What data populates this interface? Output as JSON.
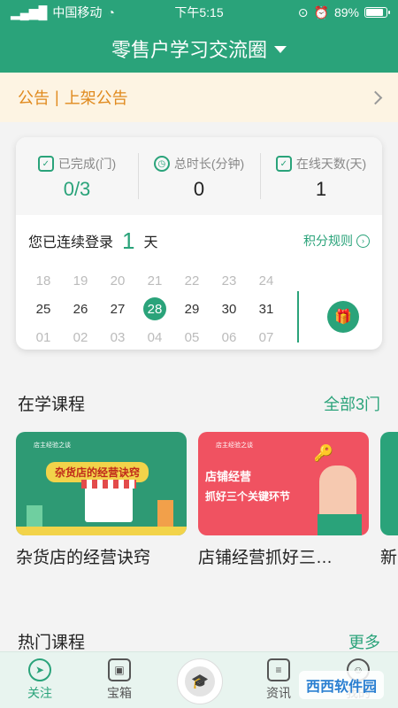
{
  "status": {
    "carrier": "中国移动",
    "time": "下午5:15",
    "battery": "89%",
    "battery_level": 0.89
  },
  "header": {
    "title": "零售户学习交流圈"
  },
  "notice": {
    "label": "公告",
    "separator": "|",
    "text": "上架公告"
  },
  "stats": [
    {
      "label": "已完成(门)",
      "value": "0/3",
      "icon": "check-doc-icon"
    },
    {
      "label": "总时长(分钟)",
      "value": "0",
      "icon": "clock-icon"
    },
    {
      "label": "在线天数(天)",
      "value": "1",
      "icon": "monitor-check-icon"
    }
  ],
  "login": {
    "prefix": "您已连续登录",
    "days": "1",
    "suffix": "天",
    "rule": "积分规则"
  },
  "calendar": {
    "rows": [
      [
        "18",
        "19",
        "20",
        "21",
        "22",
        "23",
        "24"
      ],
      [
        "25",
        "26",
        "27",
        "28",
        "29",
        "30",
        "31"
      ],
      [
        "01",
        "02",
        "03",
        "04",
        "05",
        "06",
        "07"
      ]
    ],
    "today": "28"
  },
  "learning": {
    "title": "在学课程",
    "more": "全部3门"
  },
  "courses": [
    {
      "title": "杂货店的经营诀窍",
      "banner": "杂货店的经营诀窍"
    },
    {
      "title": "店铺经营抓好三…",
      "banner_line1": "店铺经营",
      "banner_line2": "抓好三个关键环节"
    },
    {
      "title": "新"
    }
  ],
  "hot": {
    "title": "热门课程",
    "more": "更多"
  },
  "nav": [
    {
      "label": "关注",
      "icon": "compass-icon",
      "active": true
    },
    {
      "label": "宝箱",
      "icon": "chest-icon",
      "active": false
    },
    {
      "label": "资讯",
      "icon": "news-icon",
      "active": false
    },
    {
      "label": "我的",
      "icon": "user-icon",
      "active": false
    }
  ],
  "watermark": "西西软件园",
  "colors": {
    "accent": "#2aa37a",
    "notice_text": "#e08a1e",
    "notice_bg": "#fdf4e3"
  }
}
